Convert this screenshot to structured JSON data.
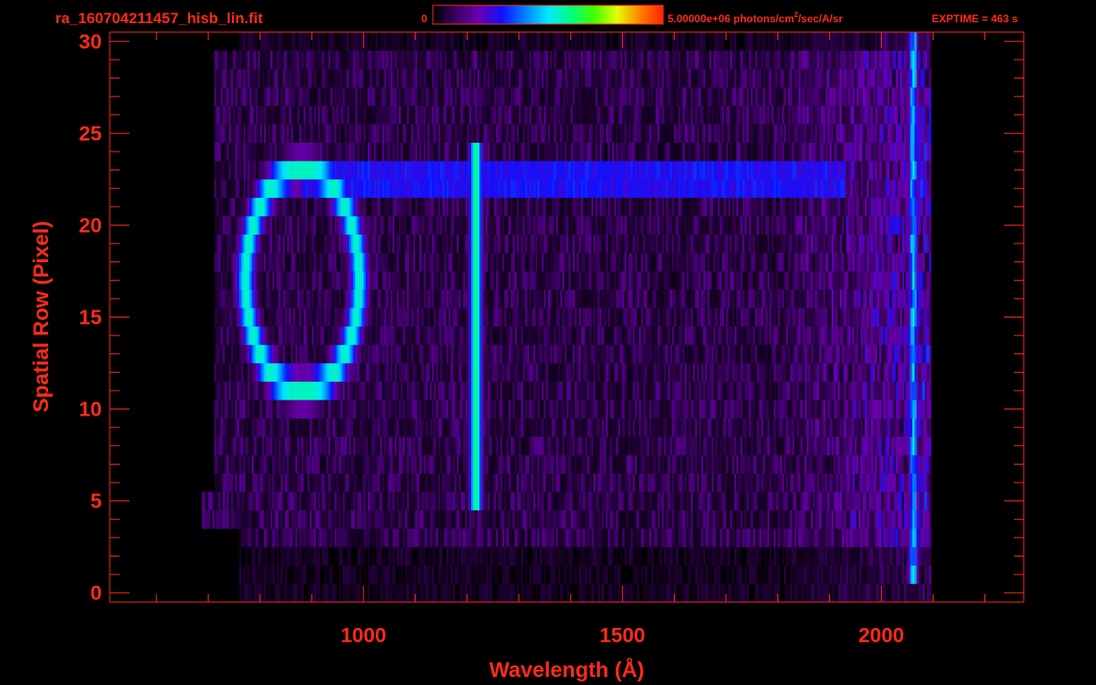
{
  "header": {
    "filename": "ra_160704211457_hisb_lin.fit",
    "colorbar_min_label": "0",
    "colorbar_max_label": "5.00000e+06 photons/cm",
    "colorbar_units_superscript": "2",
    "colorbar_units_rest": "/sec/A/sr",
    "exptime_label": "EXPTIME = 463 s"
  },
  "colors": {
    "axis": "#ff2a1a",
    "background": "#000000",
    "colormap": [
      "#000000",
      "#3a0060",
      "#6a00b0",
      "#1010ff",
      "#0080ff",
      "#00e8ff",
      "#00ff80",
      "#40ff00",
      "#e0ff00",
      "#ff8000",
      "#ff2000"
    ]
  },
  "chart_data": {
    "type": "heatmap",
    "title": "ra_160704211457_hisb_lin.fit",
    "xlabel": "Wavelength (Å)",
    "ylabel": "Spatial Row (Pixel)",
    "xlim": [
      510,
      2275
    ],
    "ylim": [
      -0.5,
      30.5
    ],
    "x_ticks": [
      1000,
      1500,
      2000
    ],
    "x_tick_labels": [
      "1000",
      "1500",
      "2000"
    ],
    "x_minor_step": 100,
    "y_ticks": [
      0,
      5,
      10,
      15,
      20,
      25,
      30
    ],
    "y_tick_labels": [
      "0",
      "5",
      "10",
      "15",
      "20",
      "25",
      "30"
    ],
    "y_minor_step": 1,
    "colorbar": {
      "min": 0,
      "max": 5000000,
      "units": "photons/cm^2/sec/A/sr",
      "scale": "linear"
    },
    "data_extent": {
      "x_start": 690,
      "x_end": 2095,
      "rows": [
        0,
        30
      ]
    },
    "features": [
      {
        "name": "ring",
        "center_x": 880,
        "center_row": 17,
        "x_radius": 110,
        "row_radius": 6,
        "peak_fraction": 0.55
      },
      {
        "name": "bar",
        "x": 1215,
        "row_range": [
          5,
          24
        ],
        "peak_fraction": 0.6
      },
      {
        "name": "horizontal_band",
        "x_range": [
          880,
          1930
        ],
        "rows": [
          22,
          23
        ],
        "peak_fraction": 0.33
      },
      {
        "name": "edge",
        "x": 2060,
        "row_range": [
          1,
          30
        ],
        "peak_fraction": 0.55
      }
    ],
    "grid": false,
    "legend": "colorbar top"
  }
}
